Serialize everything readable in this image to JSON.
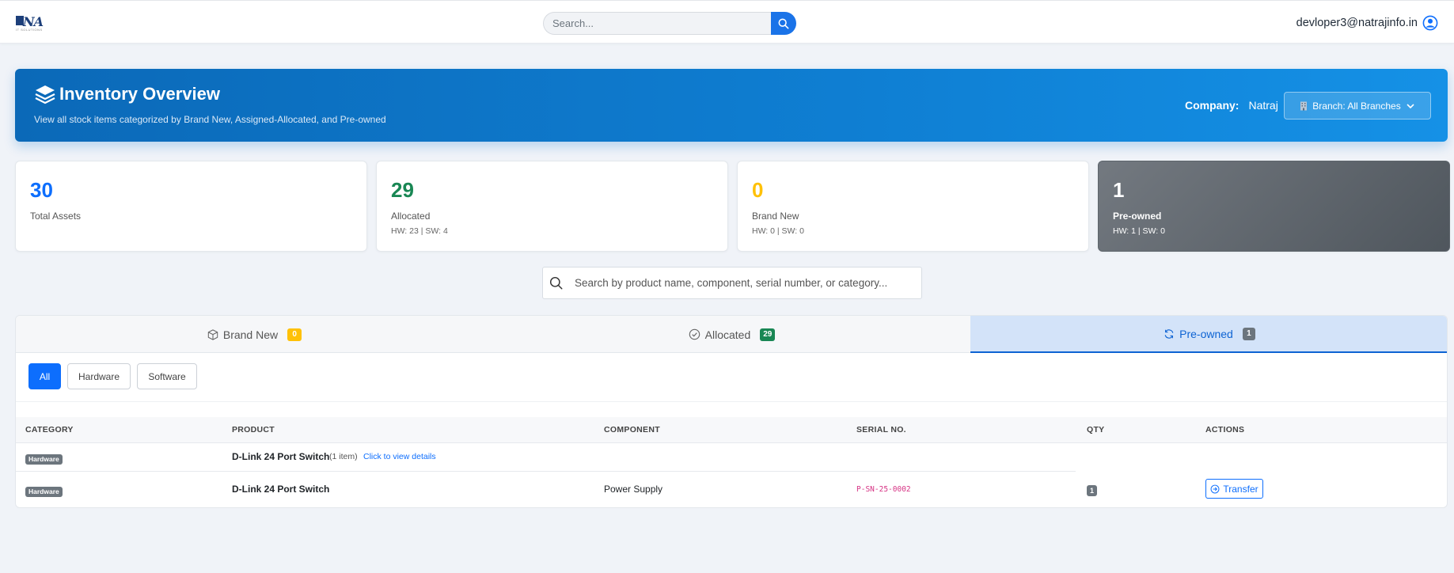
{
  "header": {
    "logo_text": "NA",
    "logo_sub": "IT SOLUTIONS",
    "search_placeholder": "Search...",
    "user_email": "devloper3@natrajinfo.in"
  },
  "hero": {
    "title": "Inventory Overview",
    "subtitle": "View all stock items categorized by Brand New, Assigned-Allocated, and Pre-owned",
    "company_label": "Company:",
    "company_value": "Natraj",
    "branch_label": "Branch: All Branches"
  },
  "stats": [
    {
      "value": "30",
      "label": "Total Assets",
      "meta": "",
      "color": "#0d6efd"
    },
    {
      "value": "29",
      "label": "Allocated",
      "meta": "HW: 23 | SW: 4",
      "color": "#198754"
    },
    {
      "value": "0",
      "label": "Brand New",
      "meta": "HW: 0 | SW: 0",
      "color": "#ffc107"
    },
    {
      "value": "1",
      "label": "Pre-owned",
      "meta": "HW: 1 | SW: 0",
      "color": "#ffffff"
    }
  ],
  "main_search": {
    "placeholder": "Search by product name, component, serial number, or category..."
  },
  "tabs": [
    {
      "label": "Brand New",
      "count": "0",
      "badge_color": "#ffc107",
      "active": false
    },
    {
      "label": "Allocated",
      "count": "29",
      "badge_color": "#198754",
      "active": false
    },
    {
      "label": "Pre-owned",
      "count": "1",
      "badge_color": "#6c757d",
      "active": true
    }
  ],
  "filters": [
    "All",
    "Hardware",
    "Software"
  ],
  "table": {
    "columns": [
      "CATEGORY",
      "PRODUCT",
      "COMPONENT",
      "SERIAL NO.",
      "QTY",
      "ACTIONS"
    ],
    "group_row": {
      "category": "Hardware",
      "product": "D-Link 24 Port Switch",
      "item_count": "(1 item)",
      "details_link": "Click to view details"
    },
    "rows": [
      {
        "category": "Hardware",
        "product": "D-Link 24 Port Switch",
        "component": "Power Supply",
        "serial": "P-SN-25-0002",
        "qty": "1",
        "action": "Transfer"
      }
    ]
  }
}
